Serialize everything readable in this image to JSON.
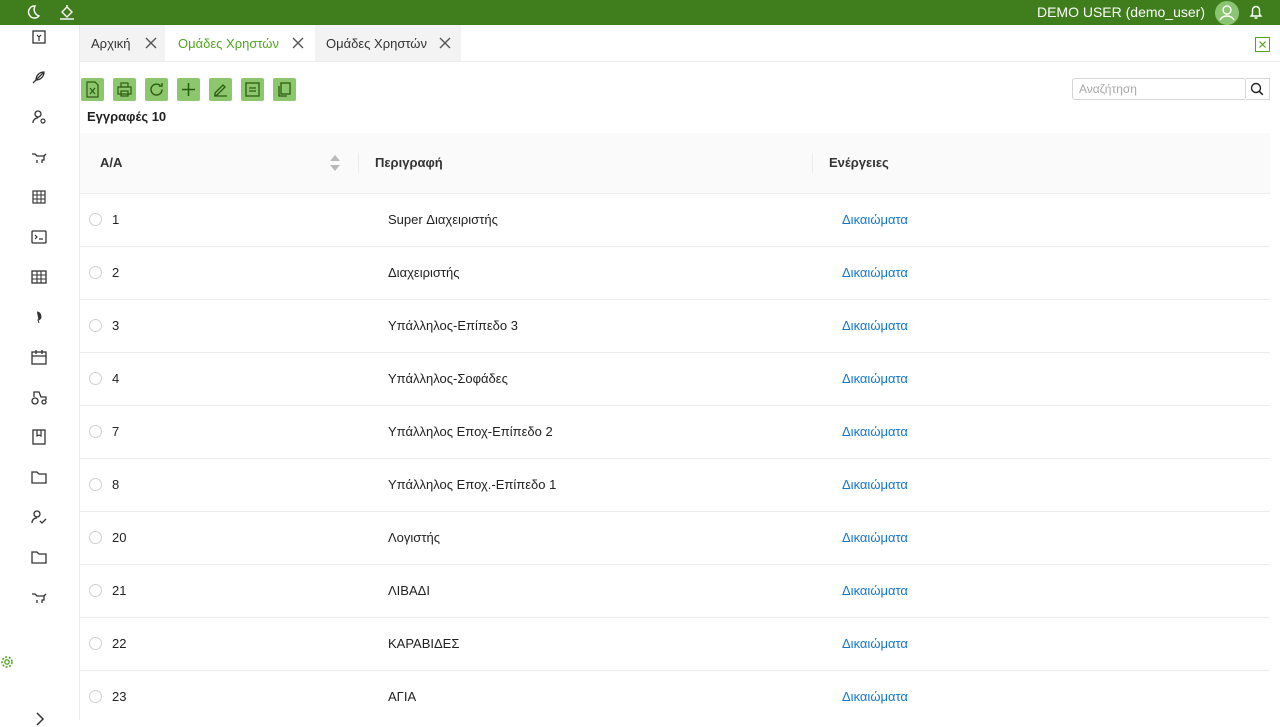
{
  "header": {
    "user": "DEMO USER (demo_user)"
  },
  "sidebar": {
    "icons": [
      "cash-register-icon",
      "feather-icon",
      "user-settings-icon",
      "cow-icon",
      "building-icon",
      "terminal-icon",
      "table-grid-icon",
      "leaf-icon",
      "calendar-icon",
      "tractor-icon",
      "book-icon",
      "folder-icon",
      "users-icon",
      "folder-icon",
      "cow-icon"
    ]
  },
  "tabs": [
    {
      "label": "Αρχική",
      "active": false
    },
    {
      "label": "Ομάδες Χρηστών",
      "active": true
    },
    {
      "label": "Ομάδες Χρηστών",
      "active": false
    }
  ],
  "toolbar": {
    "buttons": [
      "excel-export",
      "print",
      "refresh",
      "add",
      "edit",
      "copy",
      "duplicate"
    ],
    "search_placeholder": "Αναζήτηση"
  },
  "records": {
    "label": "Εγγραφές 10"
  },
  "table": {
    "headers": {
      "id": "Α/Α",
      "description": "Περιγραφή",
      "actions": "Ενέργειες"
    },
    "rows": [
      {
        "id": "1",
        "description": "Super Διαχειριστής",
        "action": "Δικαιώματα"
      },
      {
        "id": "2",
        "description": "Διαχειριστής",
        "action": "Δικαιώματα"
      },
      {
        "id": "3",
        "description": "Υπάλληλος-Επίπεδο 3",
        "action": "Δικαιώματα"
      },
      {
        "id": "4",
        "description": "Υπάλληλος-Σοφάδες",
        "action": "Δικαιώματα"
      },
      {
        "id": "7",
        "description": "Υπάλληλος Εποχ-Επίπεδο 2",
        "action": "Δικαιώματα"
      },
      {
        "id": "8",
        "description": "Υπάλληλος Εποχ.-Επίπεδο 1",
        "action": "Δικαιώματα"
      },
      {
        "id": "20",
        "description": "Λογιστής",
        "action": "Δικαιώματα"
      },
      {
        "id": "21",
        "description": "ΛΙΒΑΔΙ",
        "action": "Δικαιώματα"
      },
      {
        "id": "22",
        "description": "ΚΑΡΑΒΙΔΕΣ",
        "action": "Δικαιώματα"
      },
      {
        "id": "23",
        "description": "ΑΓΙΑ",
        "action": "Δικαιώματα"
      }
    ]
  },
  "colors": {
    "brand": "#3f7d1d",
    "accent": "#52a421",
    "button": "#8cc66d",
    "link": "#1677c8"
  }
}
